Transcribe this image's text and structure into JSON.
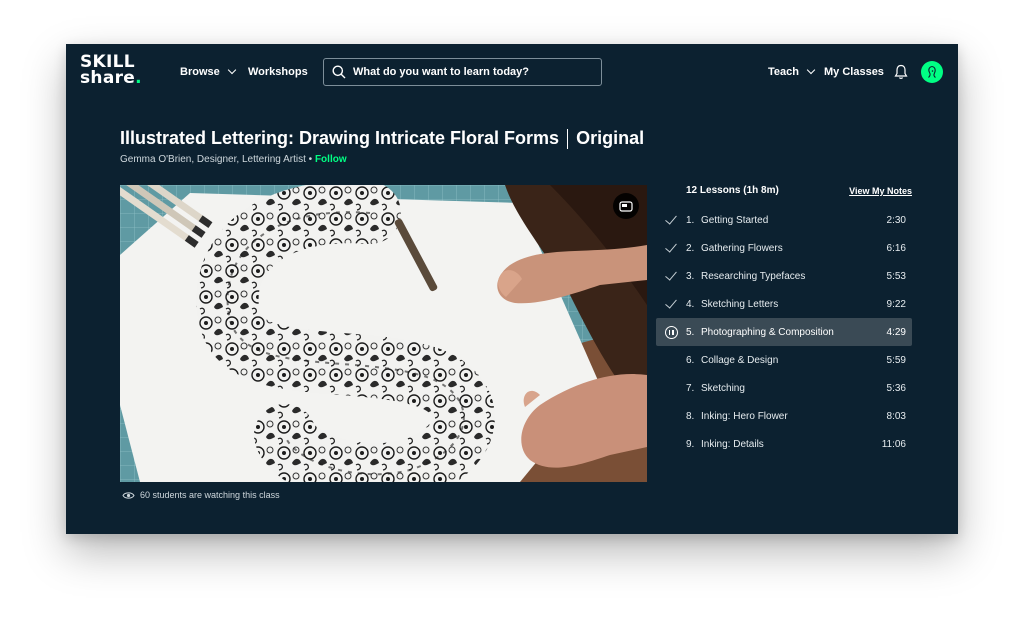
{
  "brand": {
    "line1": "SKILL",
    "line2": "share",
    "dot": ".",
    "accent": "#00ff84",
    "bg": "#0c2130"
  },
  "nav": {
    "browse": "Browse",
    "workshops": "Workshops",
    "teach": "Teach",
    "my_classes": "My Classes"
  },
  "search": {
    "placeholder": "What do you want to learn today?"
  },
  "course": {
    "title": "Illustrated Lettering: Drawing Intricate Floral Forms",
    "badge": "Original",
    "author": "Gemma O'Brien, Designer, Lettering Artist",
    "bullet": "•",
    "follow": "Follow"
  },
  "video": {
    "watching": "60 students are watching this class"
  },
  "lessons": {
    "count": "12 Lessons (1h 8m)",
    "notes_link": "View My Notes",
    "items": [
      {
        "num": "1.",
        "title": "Getting Started",
        "duration": "2:30",
        "state": "completed"
      },
      {
        "num": "2.",
        "title": "Gathering Flowers",
        "duration": "6:16",
        "state": "completed"
      },
      {
        "num": "3.",
        "title": "Researching Typefaces",
        "duration": "5:53",
        "state": "completed"
      },
      {
        "num": "4.",
        "title": "Sketching Letters",
        "duration": "9:22",
        "state": "completed"
      },
      {
        "num": "5.",
        "title": "Photographing & Composition",
        "duration": "4:29",
        "state": "playing"
      },
      {
        "num": "6.",
        "title": "Collage & Design",
        "duration": "5:59",
        "state": "pending"
      },
      {
        "num": "7.",
        "title": "Sketching",
        "duration": "5:36",
        "state": "pending"
      },
      {
        "num": "8.",
        "title": "Inking: Hero Flower",
        "duration": "8:03",
        "state": "pending"
      },
      {
        "num": "9.",
        "title": "Inking: Details",
        "duration": "11:06",
        "state": "pending"
      }
    ]
  },
  "icons": [
    "search-icon",
    "bell-icon",
    "avatar",
    "pip-icon",
    "eye-icon",
    "check-icon",
    "pause-icon"
  ]
}
